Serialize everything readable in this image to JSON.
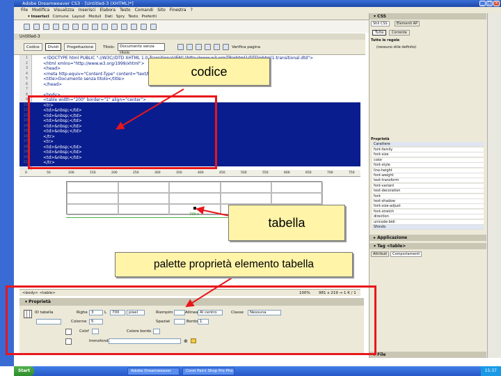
{
  "window": {
    "title": "Adobe Dreamweaver CS3 - [Untitled-3 (XHTML)*]"
  },
  "menu": [
    "File",
    "Modifica",
    "Visualizza",
    "Inserisci",
    "Elabora",
    "Testo",
    "Comandi",
    "Sito",
    "Finestra",
    "?"
  ],
  "insertbar": {
    "tabs": [
      "▾ Inserisci",
      "Comune",
      "Layout",
      "Moduli",
      "Dati",
      "Spry",
      "Testo",
      "Preferiti"
    ]
  },
  "document": {
    "tab": "Untitled-3",
    "views": {
      "code": "Codice",
      "split": "Dividi",
      "design": "Progettazione"
    },
    "title_label": "Titolo:",
    "title_value": "Documento senza titolo",
    "check_page": "Verifica pagina",
    "code_lines": [
      "<!DOCTYPE html PUBLIC \"-//W3C//DTD XHTML 1.0 Transitional//EN\" \"http://www.w3.org/TR/xhtml1/DTD/xhtml1-transitional.dtd\">",
      "<html xmlns=\"http://www.w3.org/1999/xhtml\">",
      "<head>",
      "<meta http-equiv=\"Content-Type\" content=\"text/html; charset=utf-8\" />",
      "<title>Documento senza titolo</title>",
      "</head>",
      "",
      "<body>",
      "<table width=\"200\" border=\"1\" align=\"center\">",
      "  <tr>",
      "    <td>&nbsp;</td>",
      "    <td>&nbsp;</td>",
      "    <td>&nbsp;</td>",
      "    <td>&nbsp;</td>",
      "    <td>&nbsp;</td>",
      "  </tr>",
      "  <tr>",
      "    <td>&nbsp;</td>",
      "    <td>&nbsp;</td>",
      "    <td>&nbsp;</td>",
      "  </tr>"
    ],
    "line_numbers": [
      "1",
      "2",
      "3",
      "4",
      "5",
      "6",
      "7",
      "8",
      "9",
      "10",
      "11",
      "12",
      "13",
      "14",
      "15",
      "16",
      "17",
      "18",
      "19",
      "20",
      "21"
    ],
    "ruler_marks": [
      "0",
      "50",
      "100",
      "150",
      "200",
      "250",
      "300",
      "350",
      "400",
      "450",
      "500",
      "550",
      "600",
      "650",
      "700",
      "750"
    ],
    "table_width_label": "700 ▾",
    "tag_selector": "<body> <table>",
    "zoom": "100%",
    "window_size": "981 x 219 →",
    "size_info": "1 K / 1 sec"
  },
  "properties": {
    "header": "▾ Proprietà",
    "table_label": "ID tabella",
    "rows_label": "Righe",
    "rows_value": "3",
    "cols_label": "Colonne",
    "cols_value": "5",
    "width_label": "L",
    "width_value": "700",
    "width_unit": "pixel",
    "padding_label": "Riempim",
    "spacing_label": "Spaziat",
    "align_label": "Allinea",
    "align_value": "Al centro",
    "border_label": "Bordo",
    "border_value": "1",
    "class_label": "Classe",
    "class_value": "Nessuna",
    "bgcolor_label": "Colsf",
    "bordercolor_label": "Colore bordo",
    "bgimage_label": "Immsfondo"
  },
  "css_panel": {
    "header": "▾ CSS",
    "tabs": [
      "Stili CSS",
      "Elementi AP"
    ],
    "modes": [
      "Tutte",
      "Corrente"
    ],
    "rules_label": "Tutte le regole",
    "rules_value": "(nessuno stile definito)",
    "props_label": "Proprietà",
    "groups": [
      "Carattere",
      "Sfondo"
    ],
    "font_props": [
      "font-family",
      "font-size",
      "color",
      "font-style",
      "line-height",
      "font-weight",
      "text-transform",
      "font-variant",
      "text-decoration",
      "font",
      "text-shadow",
      "font-size-adjust",
      "font-stretch",
      "direction",
      "unicode-bidi"
    ]
  },
  "app_panel": {
    "header": "▸ Applicazione"
  },
  "tag_panel": {
    "header": "▾ Tag <table>",
    "tabs": [
      "Attributi",
      "Comportamenti"
    ]
  },
  "files_panel": {
    "header": "▸ File"
  },
  "taskbar": {
    "start": "Start",
    "items": [
      "Adobe Dreamweaver",
      "Corel Paint Shop Pro Pho..."
    ],
    "clock": "15:37"
  },
  "annotations": {
    "code": "codice",
    "table": "tabella",
    "palette": "palette proprietà  elemento tabella"
  }
}
